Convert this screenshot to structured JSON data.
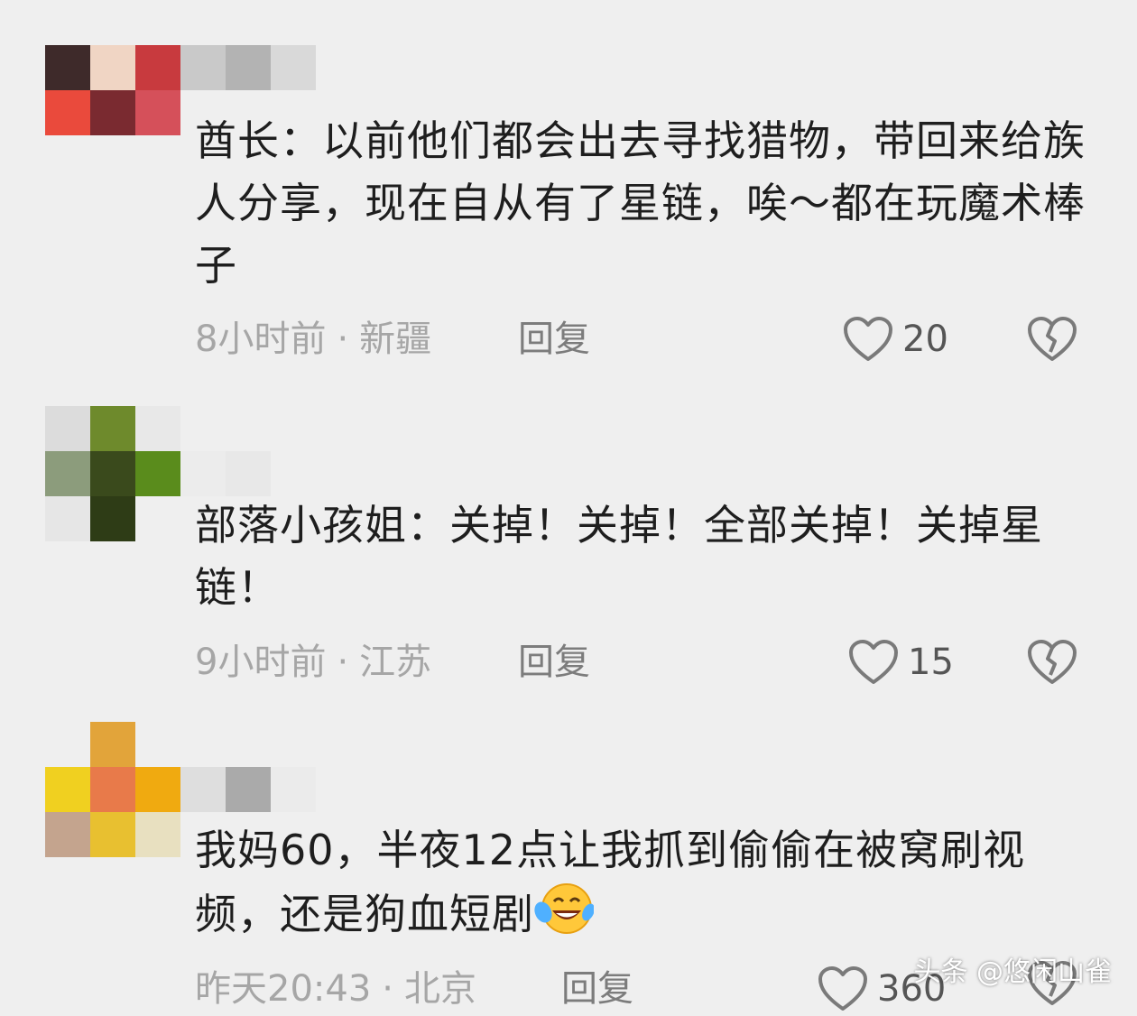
{
  "comments": [
    {
      "text": "酋长：以前他们都会出去寻找猎物，带回来给族人分享，现在自从有了星链，唉～都在玩魔术棒子",
      "time": "8小时前",
      "location": "新疆",
      "reply_label": "回复",
      "likes": "20"
    },
    {
      "text": "部落小孩姐：关掉！关掉！全部关掉！关掉星链！",
      "time": "9小时前",
      "location": "江苏",
      "reply_label": "回复",
      "likes": "15"
    },
    {
      "text": "我妈60，半夜12点让我抓到偷偷在被窝刷视频，还是狗血短剧",
      "time": "昨天20:43",
      "location": "北京",
      "reply_label": "回复",
      "likes": "360"
    }
  ],
  "separator": "·",
  "watermark": "头条 @悠闲山雀",
  "colors": {
    "background": "#efefef",
    "text": "#1e1e1e",
    "meta": "#a6a6a6",
    "reply": "#7c7c7c"
  },
  "icons": {
    "like": "heart-outline-icon",
    "dislike": "broken-heart-icon",
    "emoji": "laughing-crying-face-icon"
  }
}
